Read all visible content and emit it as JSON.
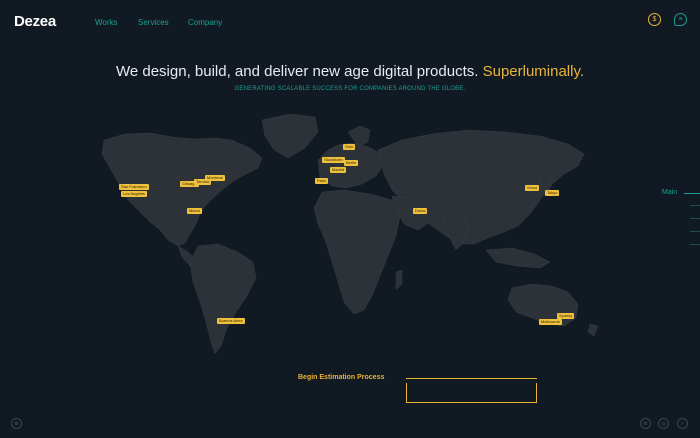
{
  "brand": {
    "logo": "Dezea"
  },
  "nav": {
    "items": [
      "Works",
      "Services",
      "Company"
    ]
  },
  "header_icons": {
    "left": "dollar-circle-icon",
    "right": "chat-bubble-icon"
  },
  "hero": {
    "headline": "We design, build, and deliver new age digital products.",
    "headline_accent": "Superluminally.",
    "subline": "GENERATING SCALABLE SUCCESS FOR COMPANIES AROUND THE GLOBE."
  },
  "map": {
    "pins": [
      {
        "label": "San Francisco"
      },
      {
        "label": "Los Angeles"
      },
      {
        "label": "Chicago"
      },
      {
        "label": "Toronto"
      },
      {
        "label": "Montreal"
      },
      {
        "label": "Miami"
      },
      {
        "label": "Oslo"
      },
      {
        "label": "Stockholm"
      },
      {
        "label": "Berlin"
      },
      {
        "label": "Paris"
      },
      {
        "label": "Madrid"
      },
      {
        "label": "Dubai"
      },
      {
        "label": "Tokyo"
      },
      {
        "label": "Seoul"
      },
      {
        "label": "Buenos Aires"
      },
      {
        "label": "Sydney"
      },
      {
        "label": "Melbourne"
      }
    ]
  },
  "sidebar": {
    "label": "Main"
  },
  "cta": {
    "label": "Begin Estimation Process"
  },
  "footer_icons": [
    "settings-icon",
    "linkedin-icon",
    "dribbble-icon",
    "twitter-icon"
  ],
  "colors": {
    "accent": "#e8b43a",
    "teal": "#1e9e93",
    "background": "#111a22",
    "land": "#2c3238"
  }
}
